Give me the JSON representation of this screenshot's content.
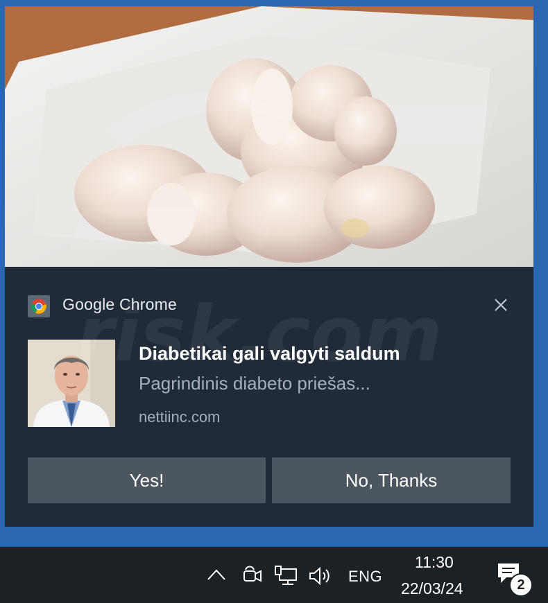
{
  "notification": {
    "app_name": "Google Chrome",
    "title": "Diabetikai gali valgyti saldum",
    "body": "Pagrindinis diabeto priešas...",
    "source": "nettiinc.com",
    "buttons": {
      "yes": "Yes!",
      "no": "No, Thanks"
    },
    "icons": {
      "app": "chrome-icon",
      "close": "close-icon"
    }
  },
  "taskbar": {
    "language": "ENG",
    "time": "11:30",
    "date": "22/03/24",
    "notification_count": "2",
    "icons": [
      "chevron-up-icon",
      "meet-now-icon",
      "network-icon",
      "volume-icon",
      "action-center-icon"
    ]
  },
  "watermark": "risk.com",
  "colors": {
    "toast_bg": "#1f2b38",
    "button_bg": "#4c5660",
    "taskbar_bg": "#1c2126",
    "desktop_bg": "#2a66b2"
  }
}
